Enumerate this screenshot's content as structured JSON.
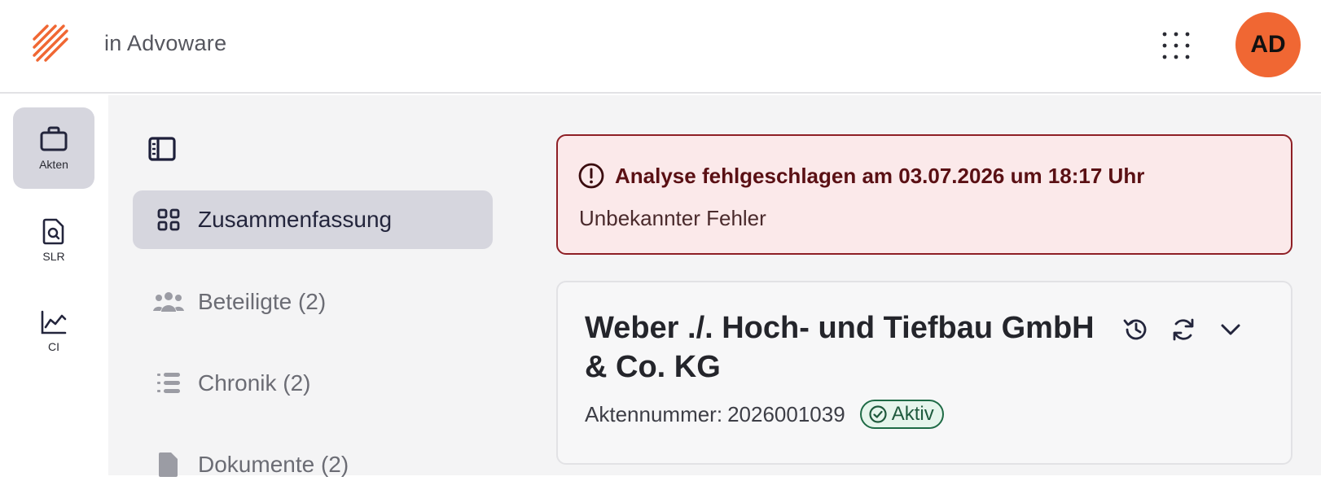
{
  "header": {
    "app_title": "in Advoware",
    "user_initials": "AD",
    "brand_color": "#f06733",
    "apps_icon": "grid-dots-icon"
  },
  "rail": {
    "items": [
      {
        "label": "Akten",
        "icon": "briefcase-icon",
        "active": true
      },
      {
        "label": "SLR",
        "icon": "document-search-icon",
        "active": false
      },
      {
        "label": "CI",
        "icon": "line-chart-icon",
        "active": false
      }
    ]
  },
  "nav": {
    "toggle_icon": "sidebar-toggle-icon",
    "items": [
      {
        "label": "Zusammenfassung",
        "icon": "grid-icon",
        "active": true
      },
      {
        "label": "Beteiligte (2)",
        "icon": "people-icon",
        "active": false
      },
      {
        "label": "Chronik (2)",
        "icon": "list-icon",
        "active": false
      },
      {
        "label": "Dokumente (2)",
        "icon": "document-icon",
        "active": false
      }
    ]
  },
  "alert": {
    "title": "Analyse fehlgeschlagen am 03.07.2026 um 18:17 Uhr",
    "message": "Unbekannter Fehler",
    "icon": "alert-circle-icon",
    "color": "#8e1f25"
  },
  "case": {
    "title": "Weber ./. Hoch- und Tiefbau GmbH & Co. KG",
    "number_label": "Aktennummer:",
    "number": "2026001039",
    "status": "Aktiv",
    "status_color": "#1f6b46",
    "actions": [
      "history-icon",
      "refresh-icon",
      "chevron-down-icon"
    ]
  }
}
